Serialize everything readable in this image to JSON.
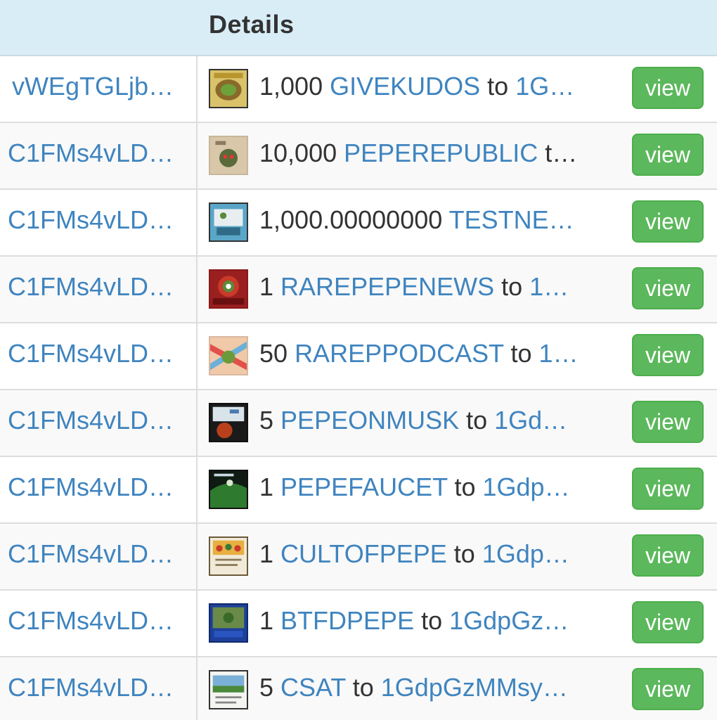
{
  "header": {
    "details_label": "Details"
  },
  "rows": [
    {
      "from": "vWEgTGLjb…",
      "qty": "1,000",
      "asset": "GIVEKUDOS",
      "to_word": " to ",
      "to_addr": "1G…",
      "view_label": "view",
      "thumb_icon": "givekudos-card-icon"
    },
    {
      "from": "C1FMs4vLD…",
      "qty": "10,000",
      "asset": "PEPEREPUBLIC",
      "to_word": " t…",
      "to_addr": "",
      "view_label": "view",
      "thumb_icon": "peperepublic-card-icon"
    },
    {
      "from": "C1FMs4vLD…",
      "qty": "1,000.00000000",
      "asset": "TESTNE…",
      "to_word": "",
      "to_addr": "",
      "view_label": "view",
      "thumb_icon": "testnet-card-icon"
    },
    {
      "from": "C1FMs4vLD…",
      "qty": "1",
      "asset": "RAREPEPENEWS",
      "to_word": " to ",
      "to_addr": "1…",
      "view_label": "view",
      "thumb_icon": "rarepepenews-card-icon"
    },
    {
      "from": "C1FMs4vLD…",
      "qty": "50",
      "asset": "RAREPPODCAST",
      "to_word": " to ",
      "to_addr": "1…",
      "view_label": "view",
      "thumb_icon": "rarepodcast-card-icon"
    },
    {
      "from": "C1FMs4vLD…",
      "qty": "5",
      "asset": "PEPEONMUSK",
      "to_word": " to ",
      "to_addr": "1Gd…",
      "view_label": "view",
      "thumb_icon": "pepeonmusk-card-icon"
    },
    {
      "from": "C1FMs4vLD…",
      "qty": "1",
      "asset": "PEPEFAUCET",
      "to_word": " to ",
      "to_addr": "1Gdp…",
      "view_label": "view",
      "thumb_icon": "pepefaucet-card-icon"
    },
    {
      "from": "C1FMs4vLD…",
      "qty": "1",
      "asset": "CULTOFPEPE",
      "to_word": " to ",
      "to_addr": "1Gdp…",
      "view_label": "view",
      "thumb_icon": "cultofpepe-card-icon"
    },
    {
      "from": "C1FMs4vLD…",
      "qty": "1",
      "asset": "BTFDPEPE",
      "to_word": " to ",
      "to_addr": "1GdpGz…",
      "view_label": "view",
      "thumb_icon": "btfdpepe-card-icon"
    },
    {
      "from": "C1FMs4vLD…",
      "qty": "5",
      "asset": "CSAT",
      "to_word": " to ",
      "to_addr": "1GdpGzMMsy…",
      "view_label": "view",
      "thumb_icon": "csat-card-icon"
    }
  ],
  "colors": {
    "link": "#3f84bf",
    "header_bg": "#d9edf7",
    "view_button": "#5cb85c",
    "text": "#333333"
  }
}
